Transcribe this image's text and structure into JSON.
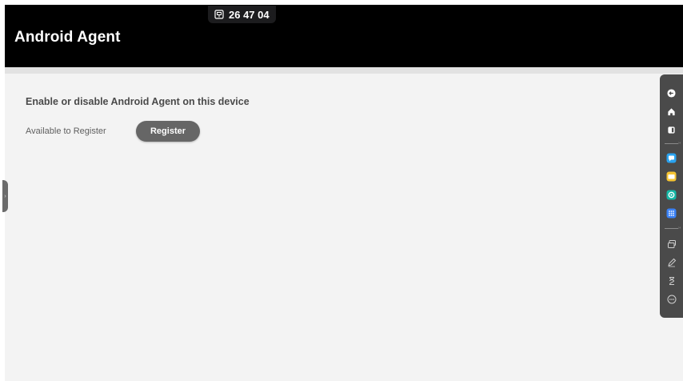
{
  "header": {
    "title": "Android Agent",
    "code_badge": "26 47 04"
  },
  "main": {
    "section_heading": "Enable or disable Android Agent on this device",
    "status_label": "Available to Register",
    "register_button": "Register"
  },
  "side_toolbar": {
    "items": [
      {
        "icon": "back-icon"
      },
      {
        "icon": "home-icon"
      },
      {
        "icon": "recent-apps-icon"
      },
      {
        "icon": "chat-app-icon"
      },
      {
        "icon": "folder-app-icon"
      },
      {
        "icon": "browser-app-icon"
      },
      {
        "icon": "app-grid-icon"
      },
      {
        "icon": "screen-mirror-icon"
      },
      {
        "icon": "annotate-pen-icon"
      },
      {
        "icon": "timer-hourglass-icon"
      },
      {
        "icon": "more-icon"
      }
    ]
  },
  "colors": {
    "header_bg": "#000000",
    "content_bg": "#f3f3f3",
    "button_bg": "#666666",
    "toolbar_bg": "#4a4a4a",
    "chat_blue": "#2aa3f0",
    "folder_yellow": "#f6c431",
    "browser_teal": "#14b8a6",
    "grid_blue": "#3b82f6"
  }
}
